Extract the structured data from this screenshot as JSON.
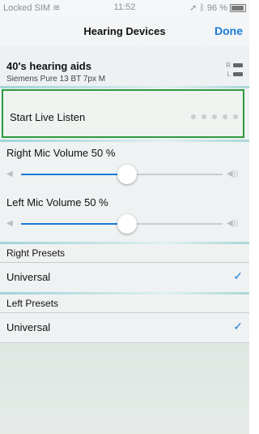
{
  "status": {
    "carrier": "Locked SIM",
    "time": "11:52",
    "battery": "96 %"
  },
  "nav": {
    "title": "Hearing Devices",
    "done": "Done"
  },
  "device": {
    "name": "40's hearing aids",
    "model": "Siemens Pure 13 BT 7px M",
    "right": "R",
    "left": "L"
  },
  "live": {
    "label": "Start Live Listen"
  },
  "right_mic": {
    "label": "Right Mic Volume  50 %",
    "value": 0.5
  },
  "left_mic": {
    "label": "Left Mic Volume  50 %",
    "value": 0.5
  },
  "right_presets": {
    "header": "Right Presets",
    "option": "Universal"
  },
  "left_presets": {
    "header": "Left Presets",
    "option": "Universal"
  },
  "icons": {
    "check": "checkmark-icon",
    "wifi": "wifi-icon",
    "speaker": "speaker-icon"
  }
}
